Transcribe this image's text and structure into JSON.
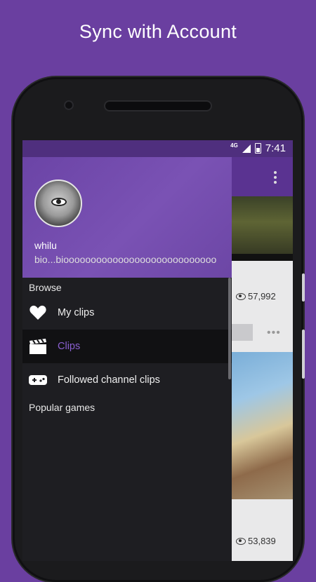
{
  "promo": {
    "headline": "Sync with Account"
  },
  "status_bar": {
    "network": "4G",
    "time": "7:41"
  },
  "drawer": {
    "user": {
      "name": "whilu",
      "bio": "bio...bioooooooooooooooooooooooooooo"
    },
    "sections": {
      "browse": "Browse",
      "popular": "Popular games"
    },
    "items": [
      {
        "label": "My clips",
        "icon": "heart-icon",
        "active": false
      },
      {
        "label": "Clips",
        "icon": "clapperboard-icon",
        "active": true
      },
      {
        "label": "Followed channel clips",
        "icon": "gamepad-icon",
        "active": false
      }
    ]
  },
  "background_list": {
    "card1_views": "57,992",
    "card2_views": "53,839"
  },
  "colors": {
    "brand": "#6a3fa0",
    "accent": "#8a5fd0"
  }
}
